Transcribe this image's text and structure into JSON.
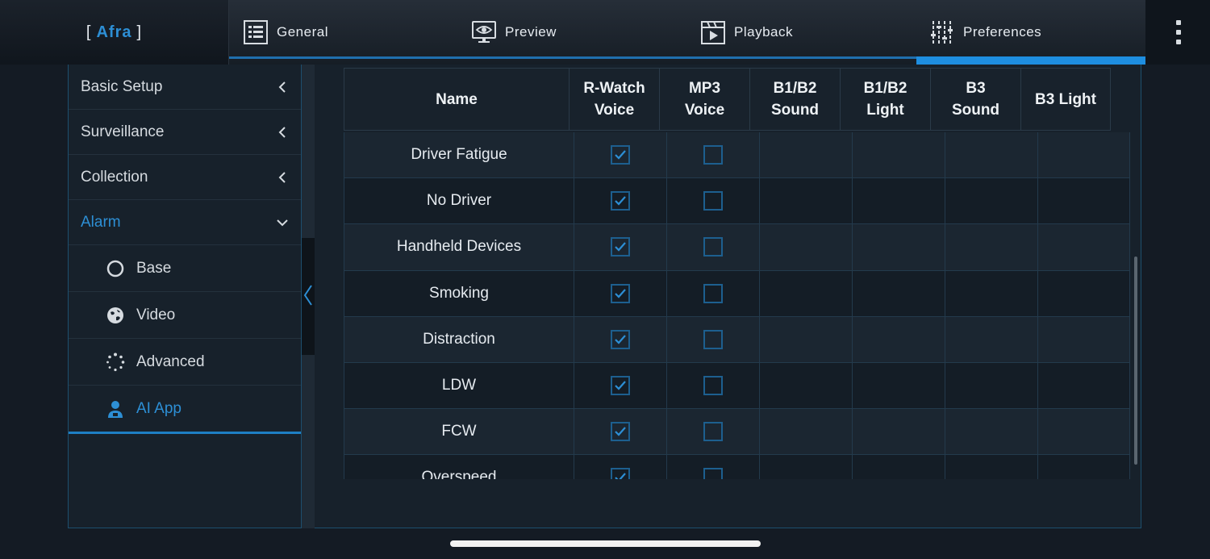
{
  "brand": {
    "open": "[",
    "name": "Afra",
    "close": "]"
  },
  "tabs": [
    {
      "label": "General",
      "icon": "grid-list-icon"
    },
    {
      "label": "Preview",
      "icon": "monitor-eye-icon"
    },
    {
      "label": "Playback",
      "icon": "film-play-icon"
    },
    {
      "label": "Preferences",
      "icon": "sliders-icon"
    }
  ],
  "active_tab": "Preferences",
  "sidebar": {
    "items": [
      {
        "label": "Basic Setup",
        "expanded": false
      },
      {
        "label": "Surveillance",
        "expanded": false
      },
      {
        "label": "Collection",
        "expanded": false
      },
      {
        "label": "Alarm",
        "expanded": true
      }
    ],
    "sub_items": [
      {
        "label": "Base",
        "icon": "circle-icon"
      },
      {
        "label": "Video",
        "icon": "globe-icon"
      },
      {
        "label": "Advanced",
        "icon": "dotted-circle-icon"
      },
      {
        "label": "AI App",
        "icon": "person-icon",
        "selected": true
      }
    ]
  },
  "table": {
    "headers": [
      [
        "Name"
      ],
      [
        "R-Watch",
        "Voice"
      ],
      [
        "MP3",
        "Voice"
      ],
      [
        "B1/B2",
        "Sound"
      ],
      [
        "B1/B2",
        "Light"
      ],
      [
        "B3",
        "Sound"
      ],
      [
        "B3 Light"
      ]
    ],
    "rows": [
      {
        "name": "Driver Fatigue",
        "rwatch_voice": true,
        "mp3_voice": false
      },
      {
        "name": "No Driver",
        "rwatch_voice": true,
        "mp3_voice": false
      },
      {
        "name": "Handheld Devices",
        "rwatch_voice": true,
        "mp3_voice": false
      },
      {
        "name": "Smoking",
        "rwatch_voice": true,
        "mp3_voice": false
      },
      {
        "name": "Distraction",
        "rwatch_voice": true,
        "mp3_voice": false
      },
      {
        "name": "LDW",
        "rwatch_voice": true,
        "mp3_voice": false
      },
      {
        "name": "FCW",
        "rwatch_voice": true,
        "mp3_voice": false
      },
      {
        "name": "Overspeed",
        "rwatch_voice": true,
        "mp3_voice": false
      }
    ]
  },
  "colors": {
    "accent": "#2d8fd5",
    "checkbox_border": "#1d5f8f",
    "background": "#141b24"
  }
}
